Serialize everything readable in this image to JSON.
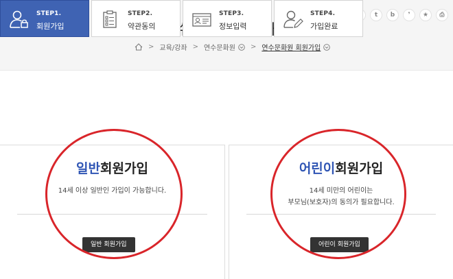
{
  "header": {
    "title": "연수문화원 회원가입",
    "breadcrumb": [
      {
        "label": "교육/강좌",
        "dropdown": false
      },
      {
        "label": "연수문화원",
        "dropdown": true
      },
      {
        "label": "연수문화원 회원가입",
        "dropdown": true
      }
    ],
    "social": [
      {
        "icon": "facebook-icon",
        "glyph": "f"
      },
      {
        "icon": "twitter-icon",
        "glyph": "t"
      },
      {
        "icon": "blog-icon",
        "glyph": "b"
      },
      {
        "icon": "story-icon",
        "glyph": "❜"
      },
      {
        "icon": "favorite-icon",
        "glyph": "★"
      },
      {
        "icon": "print-icon",
        "glyph": "⎙"
      }
    ]
  },
  "steps": [
    {
      "no": "STEP1.",
      "name": "회원가입",
      "active": true
    },
    {
      "no": "STEP2.",
      "name": "약관동의",
      "active": false
    },
    {
      "no": "STEP3.",
      "name": "정보입력",
      "active": false
    },
    {
      "no": "STEP4.",
      "name": "가입완료",
      "active": false
    }
  ],
  "cards": {
    "general": {
      "title_accent": "일반",
      "title_rest": "회원가입",
      "desc_line1": "14세 이상 일반인 가입이 가능합니다.",
      "desc_line2": "",
      "button": "일반 회원가입"
    },
    "child": {
      "title_accent": "어린이",
      "title_rest": "회원가입",
      "desc_line1": "14세 미만의 어린이는",
      "desc_line2": "부모님(보호자)의 동의가 필요합니다.",
      "button": "어린이 회원가입"
    }
  },
  "colors": {
    "accent": "#3f63b3",
    "title_accent": "#2f55b4",
    "highlight_circle": "#d9252a",
    "button_bg": "#333333"
  }
}
